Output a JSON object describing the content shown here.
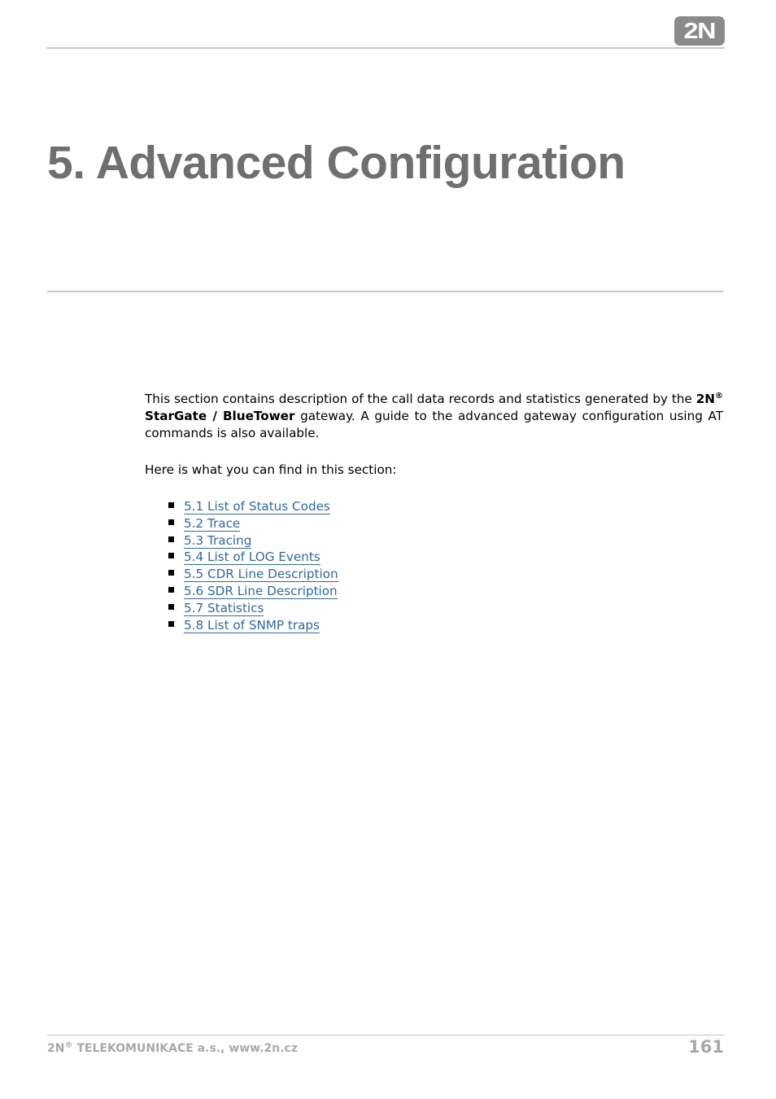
{
  "header": {
    "logo_text": "2N"
  },
  "chapter": {
    "title": "5. Advanced Configuration"
  },
  "body": {
    "intro_before": "This section contains description of the call data records and statistics generated by the ",
    "brand": "2N",
    "registered": "®",
    "product": " StarGate / BlueTower",
    "intro_after": " gateway. A guide to the advanced gateway configuration using AT commands is also available.",
    "lead": "Here is what you can find in this section:",
    "links": [
      {
        "label": "5.1 List of Status Codes"
      },
      {
        "label": "5.2 Trace"
      },
      {
        "label": "5.3 Tracing"
      },
      {
        "label": "5.4 List of LOG Events"
      },
      {
        "label": "5.5 CDR Line Description"
      },
      {
        "label": "5.6 SDR Line Description"
      },
      {
        "label": "5.7 Statistics"
      },
      {
        "label": "5.8 List of SNMP traps"
      }
    ]
  },
  "footer": {
    "company_brand": "2N",
    "registered": "®",
    "company_rest": " TELEKOMUNIKACE a.s., www.2n.cz",
    "page_number": "161"
  }
}
